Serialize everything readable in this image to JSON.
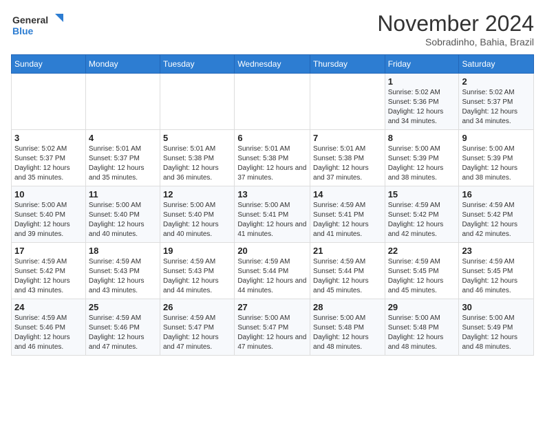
{
  "logo": {
    "line1": "General",
    "line2": "Blue"
  },
  "title": "November 2024",
  "location": "Sobradinho, Bahia, Brazil",
  "days_header": [
    "Sunday",
    "Monday",
    "Tuesday",
    "Wednesday",
    "Thursday",
    "Friday",
    "Saturday"
  ],
  "weeks": [
    [
      {
        "day": "",
        "info": ""
      },
      {
        "day": "",
        "info": ""
      },
      {
        "day": "",
        "info": ""
      },
      {
        "day": "",
        "info": ""
      },
      {
        "day": "",
        "info": ""
      },
      {
        "day": "1",
        "info": "Sunrise: 5:02 AM\nSunset: 5:36 PM\nDaylight: 12 hours and 34 minutes."
      },
      {
        "day": "2",
        "info": "Sunrise: 5:02 AM\nSunset: 5:37 PM\nDaylight: 12 hours and 34 minutes."
      }
    ],
    [
      {
        "day": "3",
        "info": "Sunrise: 5:02 AM\nSunset: 5:37 PM\nDaylight: 12 hours and 35 minutes."
      },
      {
        "day": "4",
        "info": "Sunrise: 5:01 AM\nSunset: 5:37 PM\nDaylight: 12 hours and 35 minutes."
      },
      {
        "day": "5",
        "info": "Sunrise: 5:01 AM\nSunset: 5:38 PM\nDaylight: 12 hours and 36 minutes."
      },
      {
        "day": "6",
        "info": "Sunrise: 5:01 AM\nSunset: 5:38 PM\nDaylight: 12 hours and 37 minutes."
      },
      {
        "day": "7",
        "info": "Sunrise: 5:01 AM\nSunset: 5:38 PM\nDaylight: 12 hours and 37 minutes."
      },
      {
        "day": "8",
        "info": "Sunrise: 5:00 AM\nSunset: 5:39 PM\nDaylight: 12 hours and 38 minutes."
      },
      {
        "day": "9",
        "info": "Sunrise: 5:00 AM\nSunset: 5:39 PM\nDaylight: 12 hours and 38 minutes."
      }
    ],
    [
      {
        "day": "10",
        "info": "Sunrise: 5:00 AM\nSunset: 5:40 PM\nDaylight: 12 hours and 39 minutes."
      },
      {
        "day": "11",
        "info": "Sunrise: 5:00 AM\nSunset: 5:40 PM\nDaylight: 12 hours and 40 minutes."
      },
      {
        "day": "12",
        "info": "Sunrise: 5:00 AM\nSunset: 5:40 PM\nDaylight: 12 hours and 40 minutes."
      },
      {
        "day": "13",
        "info": "Sunrise: 5:00 AM\nSunset: 5:41 PM\nDaylight: 12 hours and 41 minutes."
      },
      {
        "day": "14",
        "info": "Sunrise: 4:59 AM\nSunset: 5:41 PM\nDaylight: 12 hours and 41 minutes."
      },
      {
        "day": "15",
        "info": "Sunrise: 4:59 AM\nSunset: 5:42 PM\nDaylight: 12 hours and 42 minutes."
      },
      {
        "day": "16",
        "info": "Sunrise: 4:59 AM\nSunset: 5:42 PM\nDaylight: 12 hours and 42 minutes."
      }
    ],
    [
      {
        "day": "17",
        "info": "Sunrise: 4:59 AM\nSunset: 5:42 PM\nDaylight: 12 hours and 43 minutes."
      },
      {
        "day": "18",
        "info": "Sunrise: 4:59 AM\nSunset: 5:43 PM\nDaylight: 12 hours and 43 minutes."
      },
      {
        "day": "19",
        "info": "Sunrise: 4:59 AM\nSunset: 5:43 PM\nDaylight: 12 hours and 44 minutes."
      },
      {
        "day": "20",
        "info": "Sunrise: 4:59 AM\nSunset: 5:44 PM\nDaylight: 12 hours and 44 minutes."
      },
      {
        "day": "21",
        "info": "Sunrise: 4:59 AM\nSunset: 5:44 PM\nDaylight: 12 hours and 45 minutes."
      },
      {
        "day": "22",
        "info": "Sunrise: 4:59 AM\nSunset: 5:45 PM\nDaylight: 12 hours and 45 minutes."
      },
      {
        "day": "23",
        "info": "Sunrise: 4:59 AM\nSunset: 5:45 PM\nDaylight: 12 hours and 46 minutes."
      }
    ],
    [
      {
        "day": "24",
        "info": "Sunrise: 4:59 AM\nSunset: 5:46 PM\nDaylight: 12 hours and 46 minutes."
      },
      {
        "day": "25",
        "info": "Sunrise: 4:59 AM\nSunset: 5:46 PM\nDaylight: 12 hours and 47 minutes."
      },
      {
        "day": "26",
        "info": "Sunrise: 4:59 AM\nSunset: 5:47 PM\nDaylight: 12 hours and 47 minutes."
      },
      {
        "day": "27",
        "info": "Sunrise: 5:00 AM\nSunset: 5:47 PM\nDaylight: 12 hours and 47 minutes."
      },
      {
        "day": "28",
        "info": "Sunrise: 5:00 AM\nSunset: 5:48 PM\nDaylight: 12 hours and 48 minutes."
      },
      {
        "day": "29",
        "info": "Sunrise: 5:00 AM\nSunset: 5:48 PM\nDaylight: 12 hours and 48 minutes."
      },
      {
        "day": "30",
        "info": "Sunrise: 5:00 AM\nSunset: 5:49 PM\nDaylight: 12 hours and 48 minutes."
      }
    ]
  ]
}
